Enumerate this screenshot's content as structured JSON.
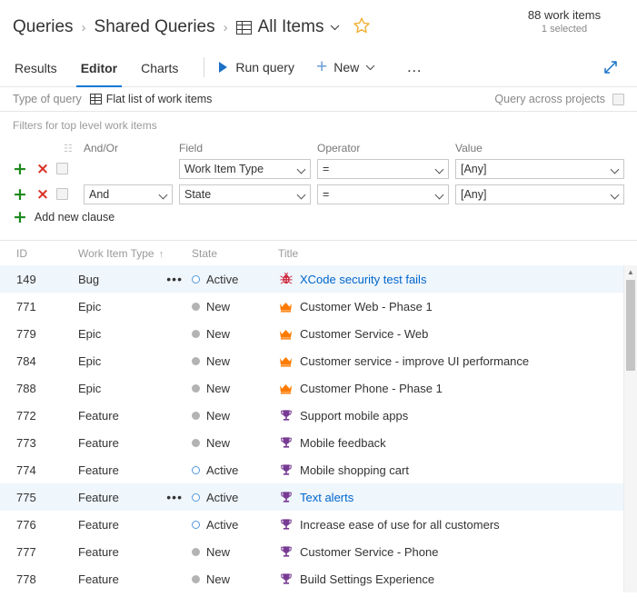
{
  "header": {
    "breadcrumb": [
      {
        "label": "Queries",
        "icon": null
      },
      {
        "label": "Shared Queries",
        "icon": null
      },
      {
        "label": "All Items",
        "icon": "grid-icon"
      }
    ],
    "separator": "›",
    "chevron": "⌵",
    "star_icon": "☆",
    "work_items_count": "88 work items",
    "selected_count": "1 selected"
  },
  "commandbar": {
    "tabs": [
      {
        "label": "Results",
        "active": false
      },
      {
        "label": "Editor",
        "active": true
      },
      {
        "label": "Charts",
        "active": false
      }
    ],
    "run_query_label": "Run query",
    "new_label": "New",
    "new_chevron": "⌵",
    "overflow_label": "…",
    "expand_title": "Expand"
  },
  "query_type": {
    "label": "Type of query",
    "value": "Flat list of work items",
    "across_projects_label": "Query across projects",
    "across_projects_checked": false
  },
  "filters": {
    "title": "Filters for top level work items",
    "columns": {
      "group": "",
      "andor": "And/Or",
      "field": "Field",
      "operator": "Operator",
      "value": "Value"
    },
    "add_icon": "+",
    "remove_icon": "×",
    "rows": [
      {
        "andor": "",
        "field": "Work Item Type",
        "operator": "=",
        "value": "[Any]",
        "checked": false
      },
      {
        "andor": "And",
        "field": "State",
        "operator": "=",
        "value": "[Any]",
        "checked": false
      }
    ],
    "add_clause_label": "Add new clause"
  },
  "grid": {
    "columns": [
      {
        "key": "id",
        "label": "ID",
        "sorted": false
      },
      {
        "key": "type",
        "label": "Work Item Type",
        "sorted": true,
        "sort_dir": "↑"
      },
      {
        "key": "state",
        "label": "State",
        "sorted": false
      },
      {
        "key": "title",
        "label": "Title",
        "sorted": false
      }
    ],
    "rows": [
      {
        "id": "149",
        "type": "Bug",
        "state": "Active",
        "title": "XCode security test fails",
        "icon": "bug-icon",
        "selected": true,
        "link": true,
        "menu": true
      },
      {
        "id": "771",
        "type": "Epic",
        "state": "New",
        "title": "Customer Web - Phase 1",
        "icon": "crown-icon",
        "selected": false,
        "link": false,
        "menu": false
      },
      {
        "id": "779",
        "type": "Epic",
        "state": "New",
        "title": "Customer Service - Web",
        "icon": "crown-icon",
        "selected": false,
        "link": false,
        "menu": false
      },
      {
        "id": "784",
        "type": "Epic",
        "state": "New",
        "title": "Customer service - improve UI performance",
        "icon": "crown-icon",
        "selected": false,
        "link": false,
        "menu": false
      },
      {
        "id": "788",
        "type": "Epic",
        "state": "New",
        "title": "Customer Phone - Phase 1",
        "icon": "crown-icon",
        "selected": false,
        "link": false,
        "menu": false
      },
      {
        "id": "772",
        "type": "Feature",
        "state": "New",
        "title": "Support mobile apps",
        "icon": "trophy-icon",
        "selected": false,
        "link": false,
        "menu": false
      },
      {
        "id": "773",
        "type": "Feature",
        "state": "New",
        "title": "Mobile feedback",
        "icon": "trophy-icon",
        "selected": false,
        "link": false,
        "menu": false
      },
      {
        "id": "774",
        "type": "Feature",
        "state": "Active",
        "title": "Mobile shopping cart",
        "icon": "trophy-icon",
        "selected": false,
        "link": false,
        "menu": false
      },
      {
        "id": "775",
        "type": "Feature",
        "state": "Active",
        "title": "Text alerts",
        "icon": "trophy-icon",
        "selected": true,
        "link": true,
        "menu": true
      },
      {
        "id": "776",
        "type": "Feature",
        "state": "Active",
        "title": "Increase ease of use for all customers",
        "icon": "trophy-icon",
        "selected": false,
        "link": false,
        "menu": false
      },
      {
        "id": "777",
        "type": "Feature",
        "state": "New",
        "title": "Customer Service - Phone",
        "icon": "trophy-icon",
        "selected": false,
        "link": false,
        "menu": false
      },
      {
        "id": "778",
        "type": "Feature",
        "state": "New",
        "title": "Build Settings Experience",
        "icon": "trophy-icon",
        "selected": false,
        "link": false,
        "menu": false
      }
    ],
    "row_menu_icon": "•••",
    "scrollbar_up_icon": "▲"
  },
  "colors": {
    "accent": "#0078d4",
    "link": "#0066cc",
    "selected_row": "#eff6fc",
    "bug": "#cc293d",
    "epic": "#ff7b00",
    "feature": "#773b93",
    "active_state": "#5197d9",
    "new_state": "#b3b3b3",
    "add_green": "#1e8a1e",
    "remove_red": "#d93025",
    "star": "#f2b035"
  }
}
